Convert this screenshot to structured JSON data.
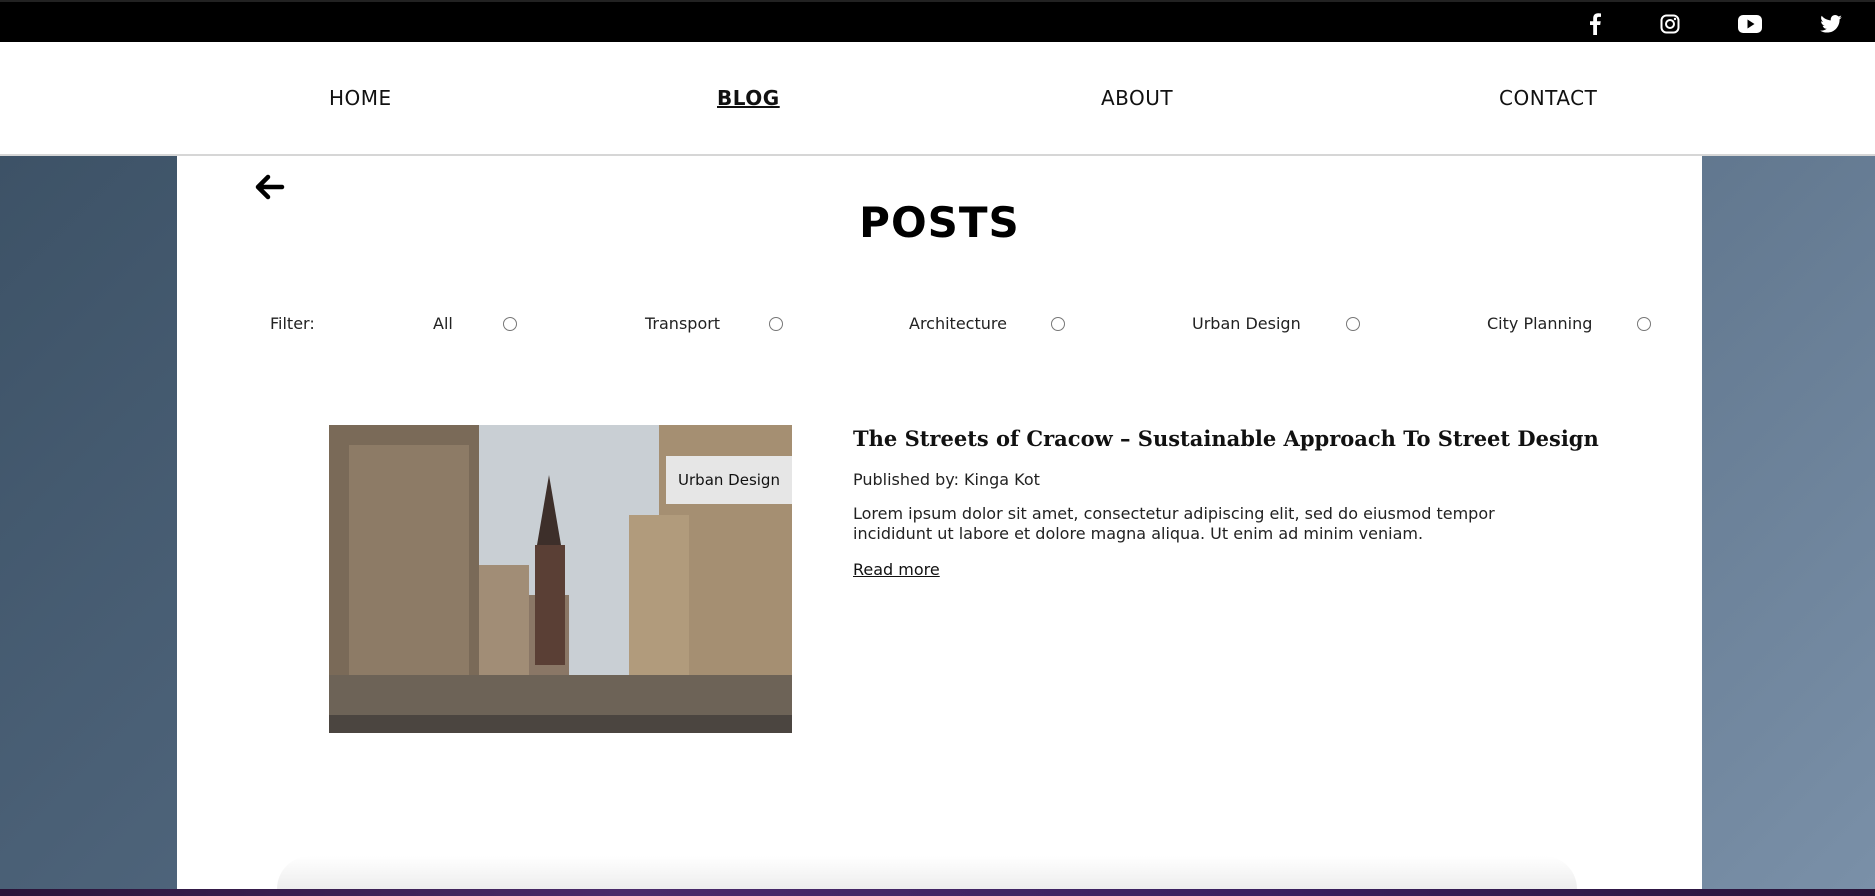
{
  "topbar": {
    "social_icons": [
      "facebook-icon",
      "instagram-icon",
      "youtube-icon",
      "twitter-icon"
    ]
  },
  "nav": {
    "items": [
      {
        "label": "HOME",
        "active": false
      },
      {
        "label": "BLOG",
        "active": true
      },
      {
        "label": "ABOUT",
        "active": false
      },
      {
        "label": "CONTACT",
        "active": false
      }
    ]
  },
  "page": {
    "back_icon": "back-arrow-icon",
    "title": "POSTS"
  },
  "filter": {
    "label": "Filter:",
    "options": [
      "All",
      "Transport",
      "Architecture",
      "Urban Design",
      "City Planning"
    ]
  },
  "posts": [
    {
      "tag": "Urban Design",
      "title": "The Streets of Cracow – Sustainable Approach To Street Design",
      "author": "Published by: Kinga Kot",
      "excerpt": "Lorem ipsum dolor sit amet, consectetur adipiscing elit, sed do eiusmod tempor incididunt ut labore et dolore magna aliqua. Ut enim ad minim veniam.",
      "read_more": "Read more"
    }
  ],
  "colors": {
    "topbar": "#000000",
    "nav_bg": "#ffffff",
    "page_bg_start": "#3a4f63",
    "page_bg_end": "#7a90a8",
    "tag_bg": "#e6e6e6"
  }
}
